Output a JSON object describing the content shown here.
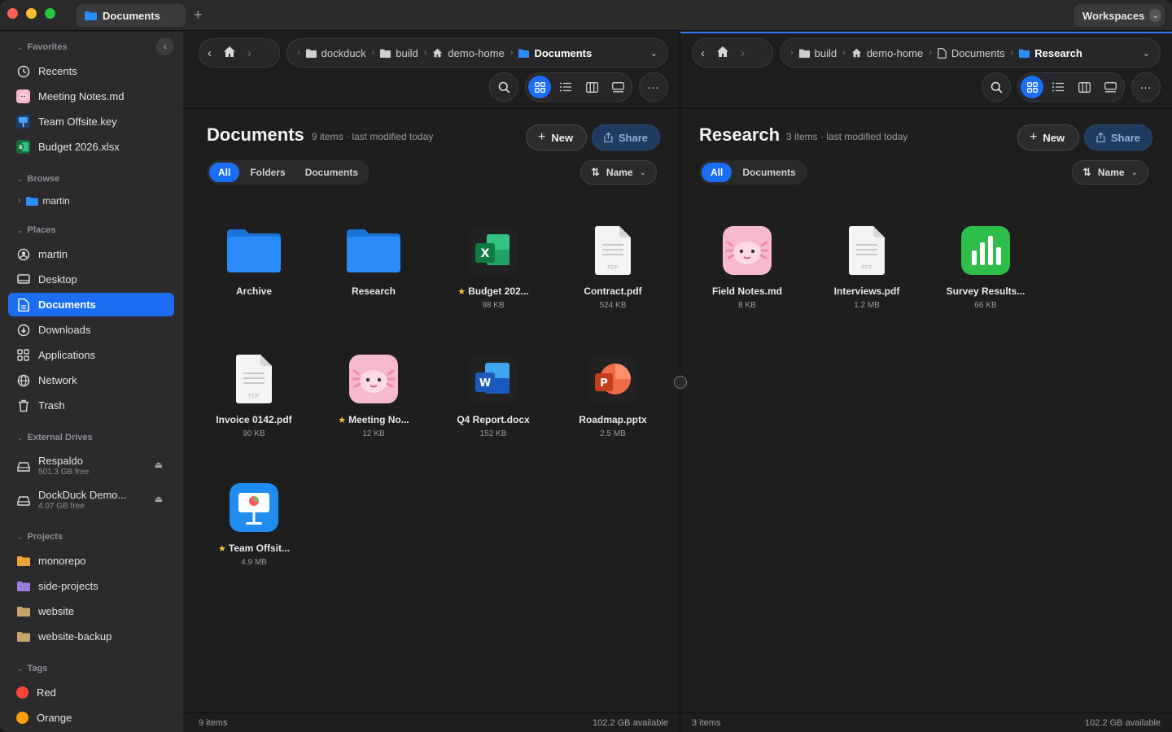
{
  "titlebar": {
    "tab_label": "Documents",
    "new_tab": "+",
    "workspaces_label": "Workspaces"
  },
  "sidebar": {
    "favorites": {
      "label": "Favorites",
      "items": [
        {
          "label": "Recents",
          "icon": "clock-icon"
        },
        {
          "label": "Meeting Notes.md",
          "icon": "axolotl-icon"
        },
        {
          "label": "Team Offsite.key",
          "icon": "keynote-icon"
        },
        {
          "label": "Budget 2026.xlsx",
          "icon": "excel-icon"
        }
      ]
    },
    "browse": {
      "label": "Browse",
      "items": [
        {
          "label": "martin",
          "icon": "folder-icon"
        }
      ]
    },
    "places": {
      "label": "Places",
      "items": [
        {
          "label": "martin",
          "icon": "user-icon"
        },
        {
          "label": "Desktop",
          "icon": "desktop-icon"
        },
        {
          "label": "Documents",
          "icon": "document-icon",
          "active": true
        },
        {
          "label": "Downloads",
          "icon": "download-icon"
        },
        {
          "label": "Applications",
          "icon": "grid-icon"
        },
        {
          "label": "Network",
          "icon": "globe-icon"
        },
        {
          "label": "Trash",
          "icon": "trash-icon"
        }
      ]
    },
    "external_drives": {
      "label": "External Drives",
      "items": [
        {
          "label": "Respaldo",
          "sub": "501.3 GB free"
        },
        {
          "label": "DockDuck Demo...",
          "sub": "4.07 GB free"
        }
      ]
    },
    "projects": {
      "label": "Projects",
      "items": [
        {
          "label": "monorepo",
          "color": "#f0a33a"
        },
        {
          "label": "side-projects",
          "color": "#9a7be0"
        },
        {
          "label": "website",
          "color": "#c7a46a"
        },
        {
          "label": "website-backup",
          "color": "#c7a46a"
        }
      ]
    },
    "tags": {
      "label": "Tags",
      "items": [
        {
          "label": "Red",
          "color": "#ff453a"
        },
        {
          "label": "Orange",
          "color": "#ff9f0a"
        }
      ]
    }
  },
  "left_pane": {
    "breadcrumbs": [
      "dockduck",
      "build",
      "demo-home",
      "Documents"
    ],
    "title": "Documents",
    "meta": "9 items · last modified today",
    "new_label": "New",
    "share_label": "Share",
    "filters": [
      "All",
      "Folders",
      "Documents"
    ],
    "sort_label": "Name",
    "files": [
      {
        "name": "Archive",
        "size": "",
        "type": "folder",
        "starred": false
      },
      {
        "name": "Research",
        "size": "",
        "type": "folder",
        "starred": false
      },
      {
        "name": "Budget 202...",
        "size": "98 KB",
        "type": "excel",
        "starred": true
      },
      {
        "name": "Contract.pdf",
        "size": "524 KB",
        "type": "pdf",
        "starred": false
      },
      {
        "name": "Invoice 0142.pdf",
        "size": "90 KB",
        "type": "pdf",
        "starred": false
      },
      {
        "name": "Meeting No...",
        "size": "12 KB",
        "type": "axolotl",
        "starred": true
      },
      {
        "name": "Q4 Report.docx",
        "size": "152 KB",
        "type": "word",
        "starred": false
      },
      {
        "name": "Roadmap.pptx",
        "size": "2.5 MB",
        "type": "powerpoint",
        "starred": false
      },
      {
        "name": "Team Offsit...",
        "size": "4.9 MB",
        "type": "keynote",
        "starred": true
      }
    ],
    "status_left": "9 items",
    "status_right": "102.2 GB available"
  },
  "right_pane": {
    "breadcrumbs": [
      "build",
      "demo-home",
      "Documents",
      "Research"
    ],
    "title": "Research",
    "meta": "3 items · last modified today",
    "new_label": "New",
    "share_label": "Share",
    "filters": [
      "All",
      "Documents"
    ],
    "sort_label": "Name",
    "files": [
      {
        "name": "Field Notes.md",
        "size": "8 KB",
        "type": "axolotl"
      },
      {
        "name": "Interviews.pdf",
        "size": "1.2 MB",
        "type": "pdf"
      },
      {
        "name": "Survey Results...",
        "size": "66 KB",
        "type": "numbers"
      }
    ],
    "status_left": "3 items",
    "status_right": "102.2 GB available"
  },
  "colors": {
    "accent": "#1b6ef3",
    "folder": "#2b8cf7"
  }
}
